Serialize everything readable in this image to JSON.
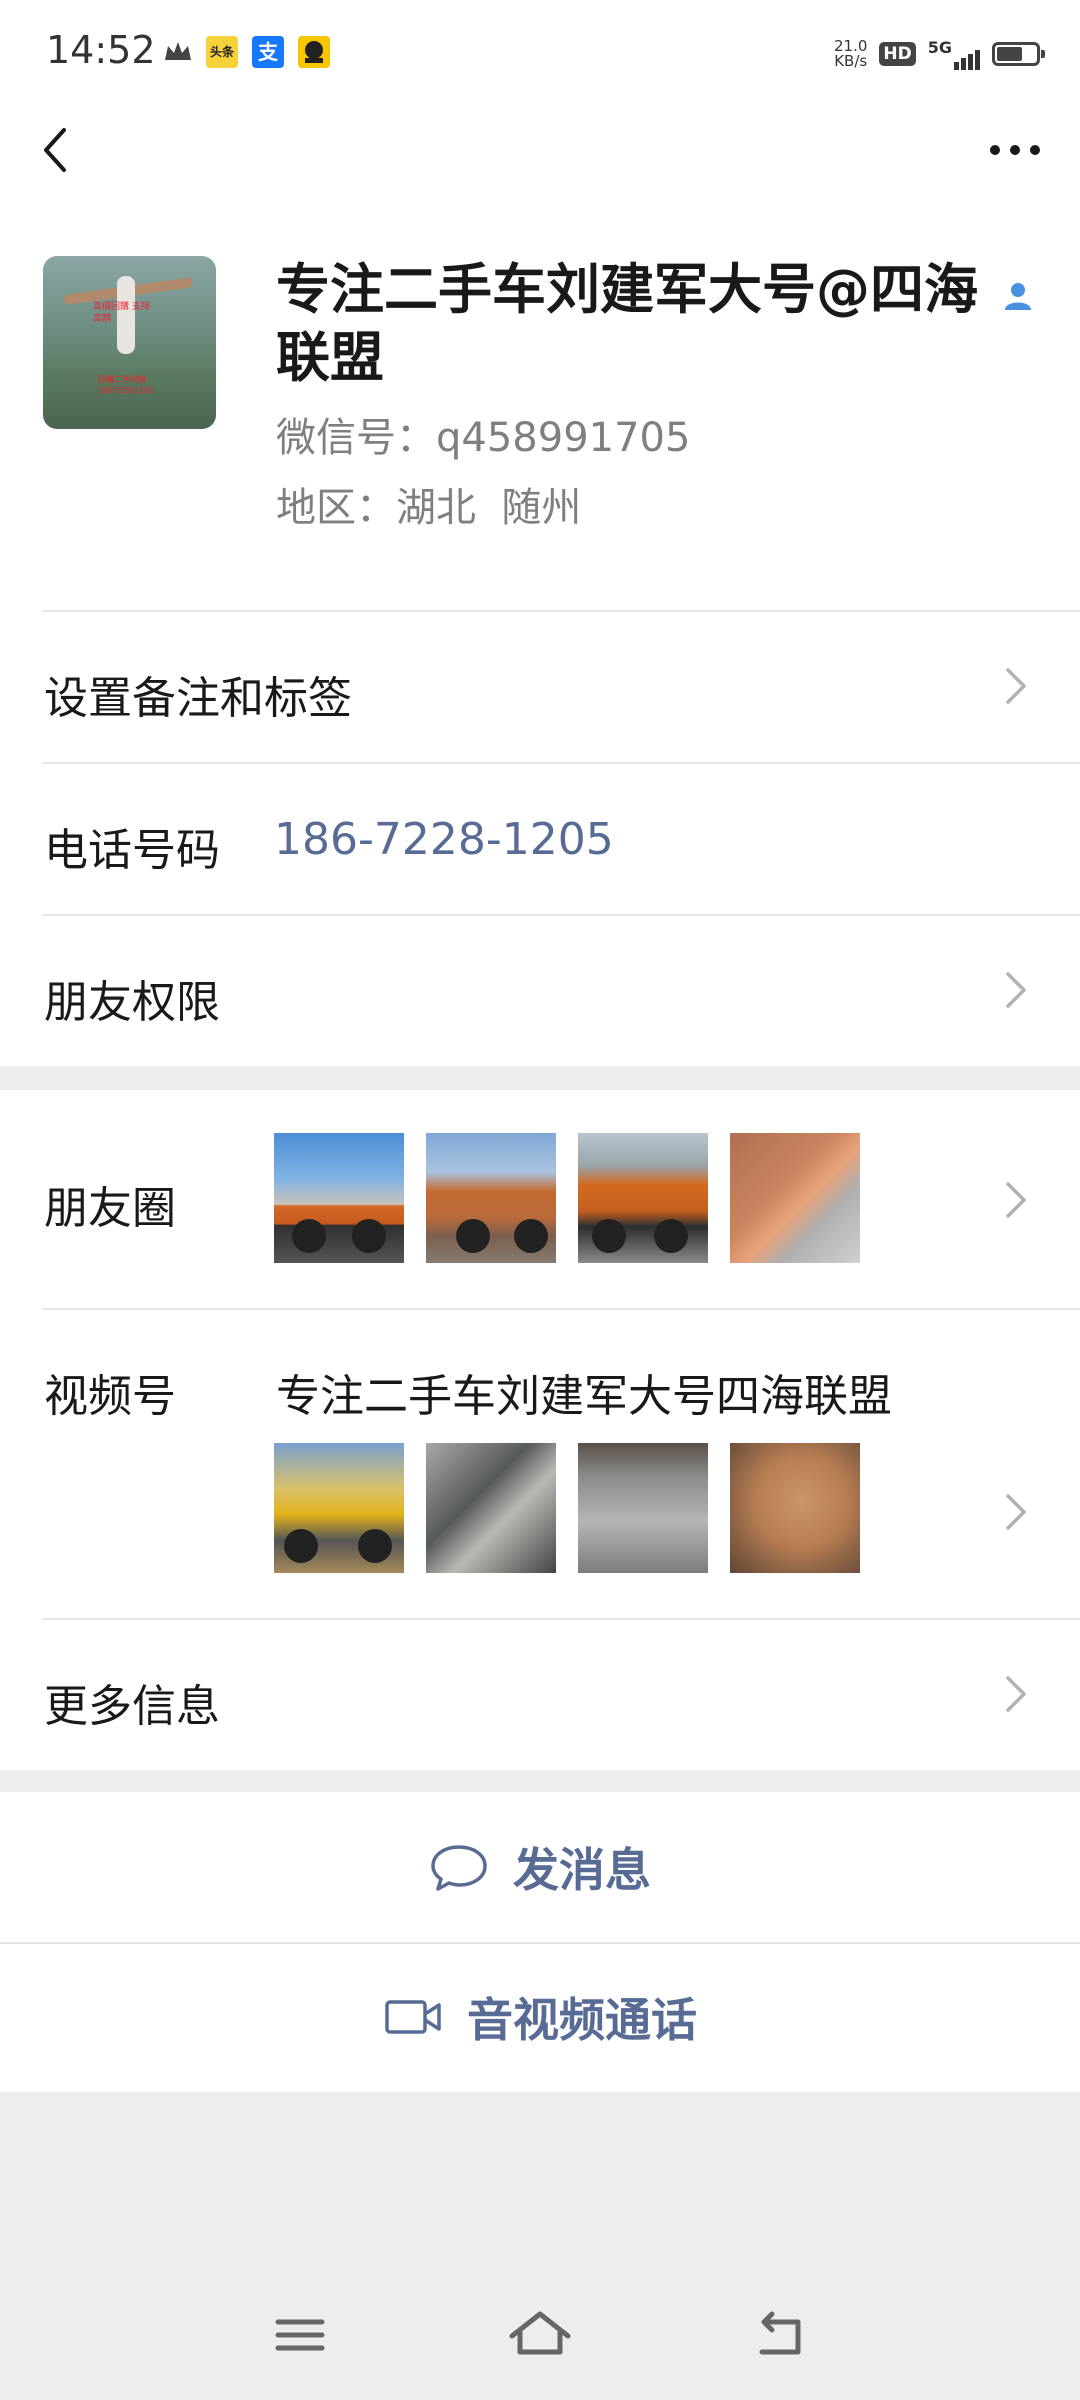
{
  "status_bar": {
    "time": "14:52",
    "app_icons": [
      "crown-icon",
      "toutiao-icon",
      "alipay-icon",
      "app-icon"
    ],
    "toutiao_label": "头条",
    "alipay_label": "支",
    "net_speed_value": "21.0",
    "net_speed_unit": "KB/s",
    "hd_label": "HD",
    "network_label": "5G"
  },
  "nav": {
    "back_icon": "chevron-left-icon",
    "more_icon": "more-icon"
  },
  "profile": {
    "name": "专注二手车刘建军大号@四海联盟",
    "wechat_id_label": "微信号：",
    "wechat_id": "q458991705",
    "region_label": "地区：",
    "region": "湖北  随州",
    "avatar_text_top": "高價回購 支持高額",
    "avatar_text_bottom": "回購二手挖機 18672281205"
  },
  "rows": {
    "remark_label": "设置备注和标签",
    "phone_label": "电话号码",
    "phone_value": "186-7228-1205",
    "permission_label": "朋友权限",
    "moments_label": "朋友圈",
    "channels_label": "视频号",
    "channels_name": "专注二手车刘建军大号四海联盟",
    "more_info_label": "更多信息"
  },
  "actions": {
    "message_label": "发消息",
    "call_label": "音视频通话"
  },
  "colors": {
    "link_blue": "#576b95",
    "background": "#ededed",
    "card": "#ffffff",
    "divider": "#e5e5e5",
    "verified_blue": "#4a90e2"
  }
}
